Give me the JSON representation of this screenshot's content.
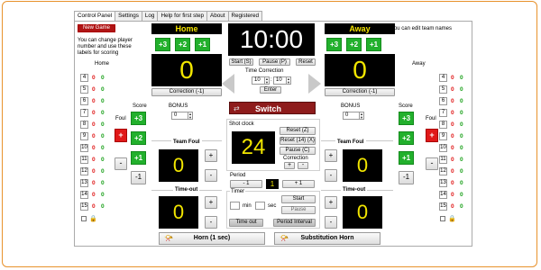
{
  "tabs": [
    {
      "label": "Control Panel"
    },
    {
      "label": "Settings"
    },
    {
      "label": "Log"
    },
    {
      "label": "Help for first step"
    },
    {
      "label": "About"
    },
    {
      "label": "Registered"
    }
  ],
  "new_game_label": "New Game",
  "hint_players": "You can change player number and use these labels for scoring",
  "hint_teams": "<You can edit team names",
  "home": {
    "name": "Home",
    "roster_label": "Home",
    "score": "0",
    "team_foul": "0",
    "timeout": "0",
    "bonus": "0",
    "players": [
      {
        "num": "4",
        "f": "0",
        "s": "0"
      },
      {
        "num": "5",
        "f": "0",
        "s": "0"
      },
      {
        "num": "6",
        "f": "0",
        "s": "0"
      },
      {
        "num": "7",
        "f": "0",
        "s": "0"
      },
      {
        "num": "8",
        "f": "0",
        "s": "0"
      },
      {
        "num": "9",
        "f": "0",
        "s": "0"
      },
      {
        "num": "10",
        "f": "0",
        "s": "0"
      },
      {
        "num": "11",
        "f": "0",
        "s": "0"
      },
      {
        "num": "12",
        "f": "0",
        "s": "0"
      },
      {
        "num": "13",
        "f": "0",
        "s": "0"
      },
      {
        "num": "14",
        "f": "0",
        "s": "0"
      },
      {
        "num": "15",
        "f": "0",
        "s": "0"
      }
    ]
  },
  "away": {
    "name": "Away",
    "roster_label": "Away",
    "score": "0",
    "team_foul": "0",
    "timeout": "0",
    "bonus": "0",
    "players": [
      {
        "num": "4",
        "f": "0",
        "s": "0"
      },
      {
        "num": "5",
        "f": "0",
        "s": "0"
      },
      {
        "num": "6",
        "f": "0",
        "s": "0"
      },
      {
        "num": "7",
        "f": "0",
        "s": "0"
      },
      {
        "num": "8",
        "f": "0",
        "s": "0"
      },
      {
        "num": "9",
        "f": "0",
        "s": "0"
      },
      {
        "num": "10",
        "f": "0",
        "s": "0"
      },
      {
        "num": "11",
        "f": "0",
        "s": "0"
      },
      {
        "num": "12",
        "f": "0",
        "s": "0"
      },
      {
        "num": "13",
        "f": "0",
        "s": "0"
      },
      {
        "num": "14",
        "f": "0",
        "s": "0"
      },
      {
        "num": "15",
        "f": "0",
        "s": "0"
      }
    ]
  },
  "labels": {
    "plus3": "+3",
    "plus2": "+2",
    "plus1": "+1",
    "minus": "-",
    "minus1": "-1",
    "plus": "+",
    "score": "Score",
    "foul": "Foul",
    "bonus": "BONUS",
    "correction_minus1": "Correction (-1)",
    "team_foul": "Team Foul",
    "timeout": "Time-out"
  },
  "clock": {
    "time": "10:00",
    "start": "Start (S)",
    "pause": "Pause (P)",
    "reset": "Reset",
    "time_correction": "Time Correction",
    "min": "10",
    "sec": "10",
    "enter": "Enter",
    "switch": "Switch"
  },
  "shot_clock": {
    "title": "Shot clock",
    "value": "24",
    "reset_z": "Reset (Z)",
    "reset_14": "Reset (14) (X)",
    "pause_c": "Pause (C)",
    "correction": "Correction",
    "plus": "+",
    "minus": "-"
  },
  "period": {
    "title": "Period",
    "minus1": "- 1",
    "value": "1",
    "plus1": "+ 1"
  },
  "timer": {
    "title": "Timer",
    "min_label": "min",
    "sec_label": "sec",
    "start": "Start",
    "pause": "Pause",
    "timeout": "Time out",
    "period_interval": "Period Interval"
  },
  "horn": {
    "horn_1sec": "Horn (1 sec)",
    "substitution": "Substitution Horn"
  },
  "colors": {
    "frame_orange": "#e8922c",
    "score_yellow": "#f2e600",
    "foul_red": "#e01818",
    "add_green": "#22b02c",
    "switch_red": "#8e1b1b"
  }
}
